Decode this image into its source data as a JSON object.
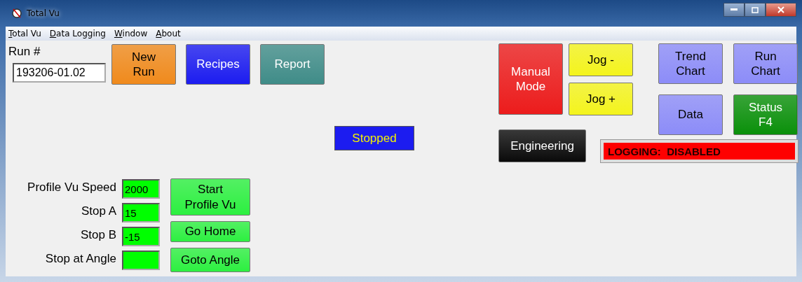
{
  "window": {
    "title": "Total Vu"
  },
  "menu": [
    {
      "label": "Total Vu"
    },
    {
      "label": "Data Logging"
    },
    {
      "label": "Window"
    },
    {
      "label": "About"
    }
  ],
  "run_number": {
    "label": "Run #",
    "value": "193206-01.02"
  },
  "buttons": [
    {
      "label": "New\nRun",
      "color": "#f08a1c"
    },
    {
      "label": "Recipes",
      "color": "#1c1cf0"
    },
    {
      "label": "Report",
      "color": "#3f8c88"
    },
    {
      "label": "Manual\nMode",
      "color": "#ec1c1c"
    },
    {
      "label": "Jog -",
      "color": "#f4f41c"
    },
    {
      "label": "Jog +",
      "color": "#f4f41c"
    },
    {
      "label": "Engineering",
      "color": "#0a0a0a"
    },
    {
      "label": "Trend\nChart",
      "color": "#8c8cf8"
    },
    {
      "label": "Run\nChart",
      "color": "#8c8cf8"
    },
    {
      "label": "Data",
      "color": "#8c8cf8"
    },
    {
      "label": "Status\nF4",
      "color": "#0a900a"
    },
    {
      "label": "Start\nProfile Vu",
      "color": "#2cf040"
    },
    {
      "label": "Go Home",
      "color": "#2cf040"
    },
    {
      "label": "Goto Angle",
      "color": "#2cf040"
    }
  ],
  "status": {
    "text": "Stopped",
    "color": "#1c1cf0"
  },
  "logging": {
    "text": "LOGGING:  DISABLED",
    "color": "#fe0000"
  },
  "profile_fields": [
    {
      "label": "Profile Vu Speed",
      "value": "2000"
    },
    {
      "label": "Stop A",
      "value": "15"
    },
    {
      "label": "Stop B",
      "value": "-15"
    },
    {
      "label": "Stop at Angle"
    }
  ]
}
